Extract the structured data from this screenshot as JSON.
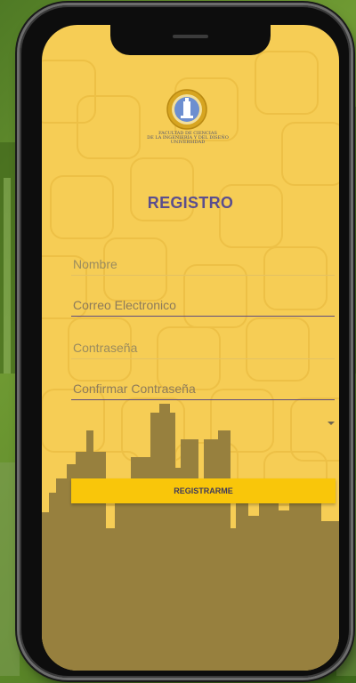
{
  "screen": {
    "title": "REGISTRO",
    "logo_lines": [
      "FACULTAD DE CIENCIAS",
      "DE LA INGENIERÍA Y DEL DISEÑO",
      "UNIVERSIDAD"
    ]
  },
  "form": {
    "name_placeholder": "Nombre",
    "email_placeholder": "Correo Electronico",
    "password_placeholder": "Contraseña",
    "confirm_placeholder": "Confirmar Contraseña",
    "dropdown_value": "",
    "submit_label": "REGISTRARME"
  },
  "colors": {
    "screen_background": "#f6cd55",
    "title": "#5b4e8e",
    "button": "#f9c60a",
    "skyline": "#97803e",
    "outer_background": "#5f8a2a"
  },
  "icons": {
    "logo": "university-seal-icon",
    "dropdown": "caret-down-icon"
  }
}
